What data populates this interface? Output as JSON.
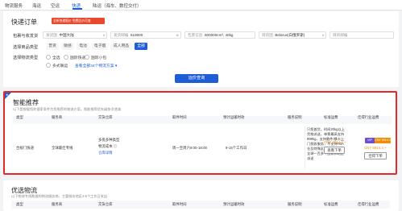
{
  "topnav": {
    "items": [
      "物流服务",
      "海运",
      "空运",
      "快递",
      "陆运（海车、数控交付）"
    ],
    "active_index": 3
  },
  "quick_order": {
    "title": "快递订单",
    "badge": "全新快递报价 免费比价可查",
    "row1_label": "包裹与收发货",
    "origin_placeholder": "发货国",
    "origin_value": "中国大陆",
    "zip_placeholder": "发货邮编",
    "zip_value": "518000",
    "parcel_placeholder": "包裹信息",
    "parcel_value": "600000cm³, 40kg",
    "dest_placeholder": "目的国",
    "dest_value": "Belarus(白俄罗斯)",
    "dest_zip_placeholder": "目的邮编",
    "row2_label": "选择商品类型",
    "goods": [
      "普货",
      "敏感",
      "电池",
      "电子烟",
      "成人用品",
      "全部"
    ],
    "goods_active_index": 5,
    "row3_label": "选择物流类型",
    "ltypes": [
      "全选",
      "国际快递",
      "国际小包",
      "多式联运"
    ],
    "ltypes_link": "查看全部34个物流方案 ▾",
    "query_button": "运价查询"
  },
  "smart": {
    "title": "智能推荐",
    "subtitle": "以下是根据您的搜索条件为您推荐的物流方案，智能推荐优先级依次递减",
    "headers": [
      "类型",
      "服务商",
      "交货仓库",
      "取件时间",
      "预计运输时效",
      "服务说明",
      "标准运费",
      "佳得行业运费"
    ],
    "row": {
      "type": "合规门快递",
      "provider": "全球最佳专线",
      "warehouse_line1": "多揽多种类型",
      "warehouse_line2": "物流成本 ⓘ",
      "warehouse_link": "仓库详情",
      "pickup": "周一至周六9:00-18:00",
      "transit": "9-15个工作日",
      "description": "只揽普货，时间20kg以上货物派送，单票最高支持999kg，支持散件/横卡上门揽收服务，不支持FBA仓及特殊区域地址，支持全球一百多个国家和地区派送",
      "standard_price": "CNY 8914.4 ~",
      "order_button": "查看下单",
      "pill_tag": "VIP",
      "pill_price": "CNY 8914.4 ~",
      "member_price": "CNY 8914.4 ~",
      "member_button": "佳得下单"
    }
  },
  "preferred": {
    "title": "优选物流",
    "subtitle": "以下物流专线数据的物流服务商，主要服务地区4-5个工作日发出",
    "headers": [
      "类型",
      "服务商",
      "交货仓库",
      "取件时间",
      "预计运输时效",
      "服务说明",
      "标准运费",
      "佳得行业运费"
    ]
  },
  "colors": {
    "brand_blue": "#1f5dd7",
    "badge_red": "#e8482d",
    "highlight_border": "#e02b2b",
    "price_orange": "#f08c00",
    "vip_purple": "#6b4ed8"
  }
}
